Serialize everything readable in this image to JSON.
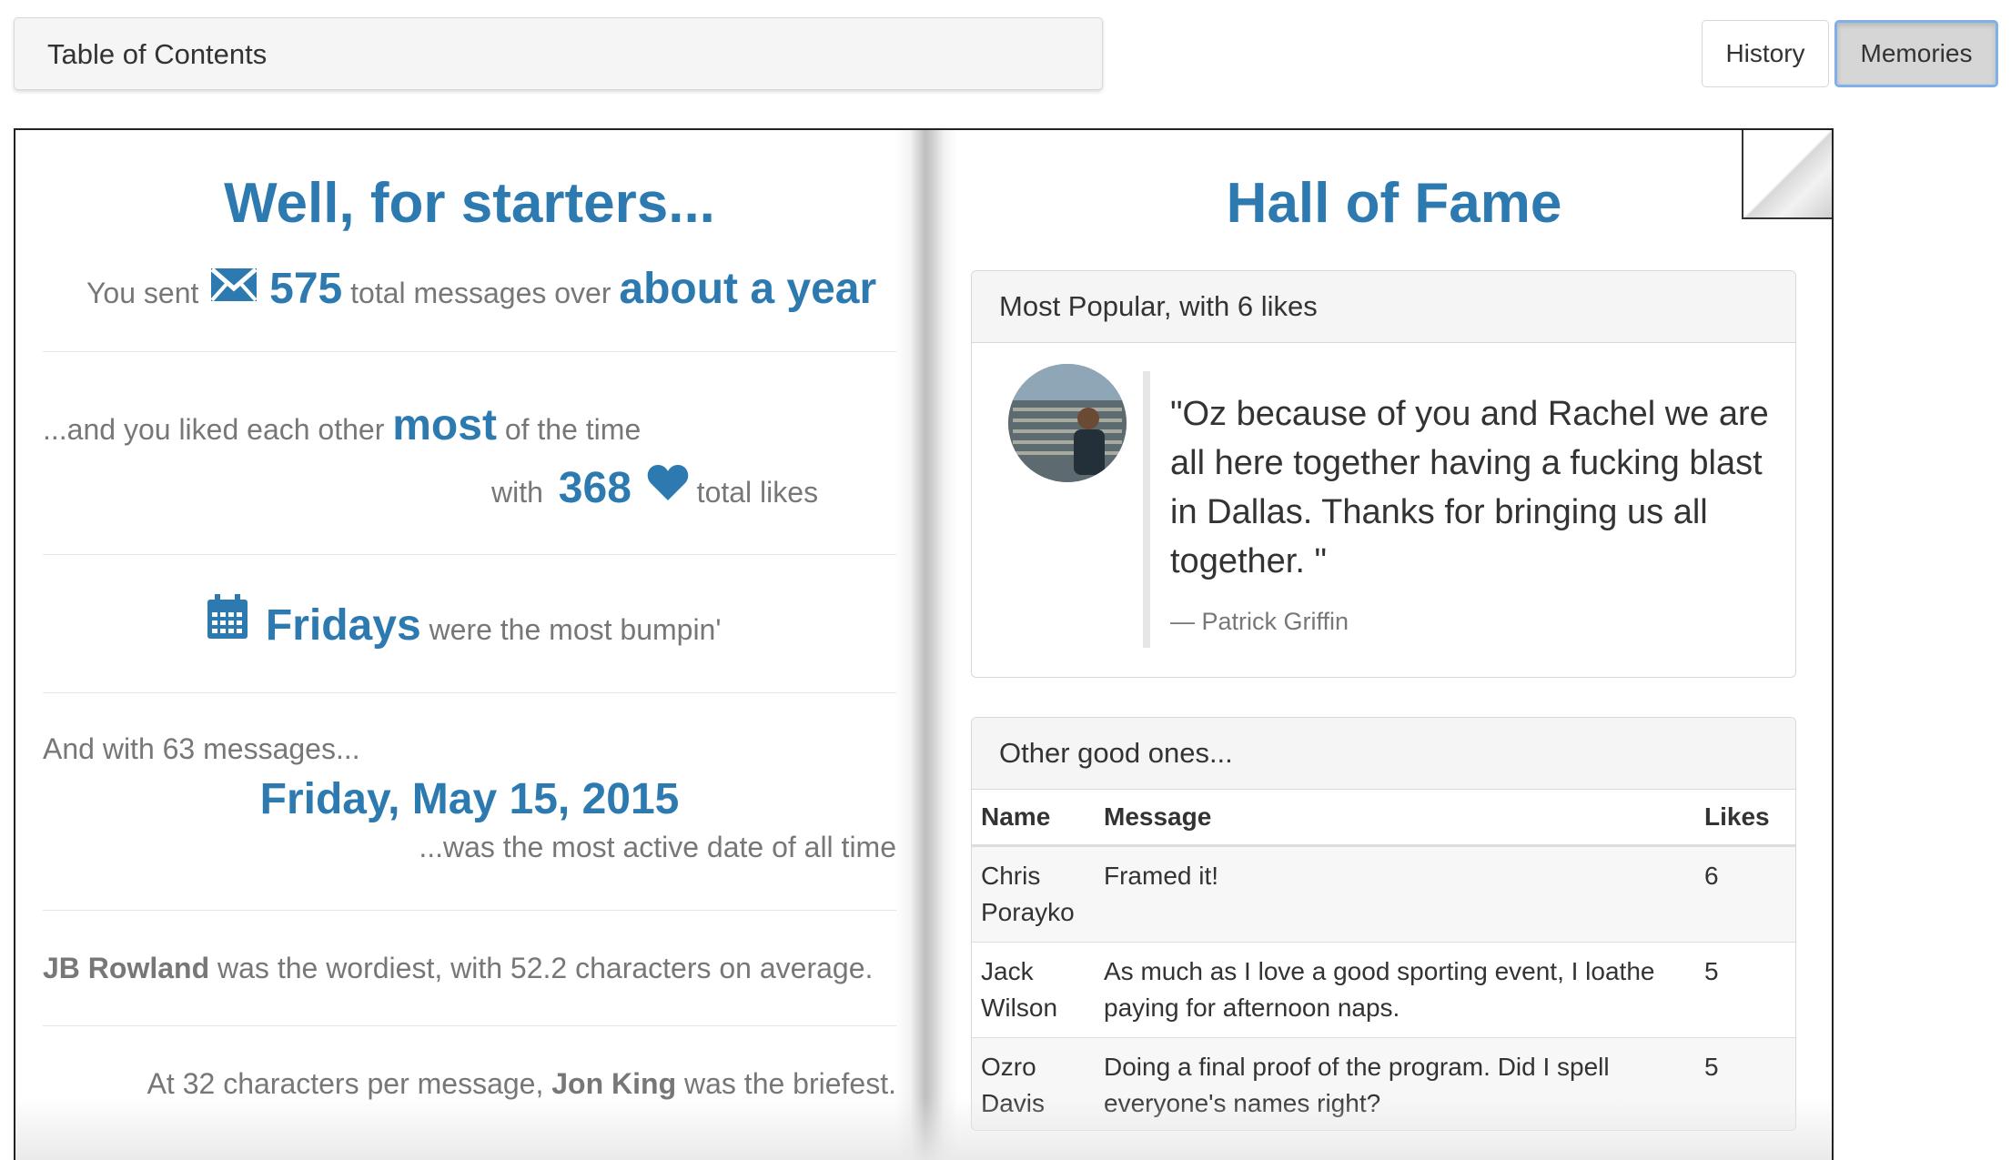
{
  "topbar": {
    "toc_label": "Table of Contents",
    "history_label": "History",
    "memories_label": "Memories"
  },
  "left": {
    "heading": "Well, for starters...",
    "sent_prefix": "You sent",
    "message_count": "575",
    "sent_mid": "total messages over",
    "duration": "about a year",
    "liked_prefix": "...and you liked each other",
    "liked_big": "most",
    "liked_suffix": "of the time",
    "likes_prefix": "with",
    "likes_count": "368",
    "likes_suffix": "total likes",
    "day_big": "Fridays",
    "day_suffix": "were the most bumpin'",
    "active_intro": "And with 63 messages...",
    "active_date": "Friday, May 15, 2015",
    "active_suffix": "...was the most active date of all time",
    "wordiest_name": "JB Rowland",
    "wordiest_text": "was the wordiest, with 52.2 characters on average.",
    "briefest_prefix": "At 32 characters per message,",
    "briefest_name": "Jon King",
    "briefest_suffix": "was the briefest."
  },
  "right": {
    "heading": "Hall of Fame",
    "popular_title": "Most Popular, with 6 likes",
    "quote": "\"Oz because of you and Rachel we are all here together having a fucking blast in Dallas. Thanks for bringing us all together. \"",
    "quote_author": "— Patrick Griffin",
    "others_title": "Other good ones...",
    "columns": [
      "Name",
      "Message",
      "Likes"
    ],
    "rows": [
      {
        "name": "Chris Porayko",
        "message": "Framed it!",
        "likes": "6"
      },
      {
        "name": "Jack Wilson",
        "message": "As much as I love a good sporting event, I loathe paying for afternoon naps.",
        "likes": "5"
      },
      {
        "name": "Ozro Davis",
        "message": "Doing a final proof of the program. Did I spell everyone's names right?",
        "likes": "5"
      }
    ]
  },
  "icons": {
    "envelope": "envelope-icon",
    "heart": "heart-icon",
    "calendar": "calendar-icon",
    "avatar": "avatar"
  },
  "colors": {
    "accent_blue": "#2d7ab0",
    "muted_text": "#777777",
    "active_button_border": "#7fb1e8"
  }
}
